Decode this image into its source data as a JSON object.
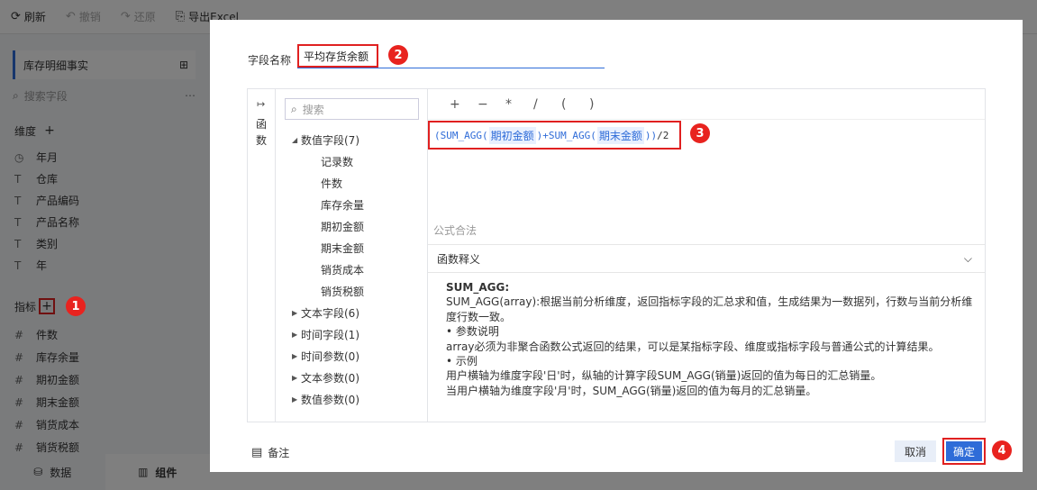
{
  "toolbar": {
    "refresh": "刷新",
    "undo": "撤销",
    "redo": "还原",
    "export": "导出Excel"
  },
  "left": {
    "cube_name": "库存明细事实",
    "search_placeholder": "搜索字段",
    "dimensions_title": "维度",
    "dimensions": [
      {
        "type": "date",
        "label": "年月"
      },
      {
        "type": "text",
        "label": "仓库"
      },
      {
        "type": "text",
        "label": "产品编码"
      },
      {
        "type": "text",
        "label": "产品名称"
      },
      {
        "type": "text",
        "label": "类别"
      },
      {
        "type": "text",
        "label": "年"
      }
    ],
    "measures_title": "指标",
    "measures": [
      "件数",
      "库存余量",
      "期初金额",
      "期末金额",
      "销货成本",
      "销货税额"
    ],
    "tab_data": "数据",
    "tab_component": "组件"
  },
  "dialog": {
    "field_name_label": "字段名称",
    "field_name_value": "平均存货余额",
    "rail_label": "函数",
    "tree_search_placeholder": "搜索",
    "tree": [
      {
        "label": "数值字段(7)",
        "expanded": true,
        "children": [
          "记录数",
          "件数",
          "库存余量",
          "期初金额",
          "期末金额",
          "销货成本",
          "销货税额"
        ]
      },
      {
        "label": "文本字段(6)",
        "expanded": false
      },
      {
        "label": "时间字段(1)",
        "expanded": false
      },
      {
        "label": "时间参数(0)",
        "expanded": false
      },
      {
        "label": "文本参数(0)",
        "expanded": false
      },
      {
        "label": "数值参数(0)",
        "expanded": false
      }
    ],
    "operators": [
      "+",
      "−",
      "*",
      "/",
      "(",
      ")"
    ],
    "formula": {
      "p1": "(SUM_AGG(",
      "f1": "期初金额",
      "p2": ")+SUM_AGG(",
      "f2": "期末金额",
      "p3": "))",
      "p4": "/2"
    },
    "status": "公式合法",
    "desc_title": "函数释义",
    "desc": {
      "name": "SUM_AGG:",
      "line1": "SUM_AGG(array):根据当前分析维度，返回指标字段的汇总求和值，生成结果为一数据列，行数与当前分析维度行数一致。",
      "line2": "• 参数说明",
      "line3": "array必须为非聚合函数公式返回的结果，可以是某指标字段、维度或指标字段与普通公式的计算结果。",
      "line4": "• 示例",
      "line5": "用户横轴为维度字段'日'时，纵轴的计算字段SUM_AGG(销量)返回的值为每日的汇总销量。",
      "line6": "当用户横轴为维度字段'月'时，SUM_AGG(销量)返回的值为每月的汇总销量。"
    },
    "note": "备注",
    "cancel": "取消",
    "ok": "确定"
  },
  "badges": [
    "1",
    "2",
    "3",
    "4"
  ],
  "colors": {
    "accent": "#2f6cd8",
    "highlight": "#e02020",
    "badge": "#e8231f"
  }
}
